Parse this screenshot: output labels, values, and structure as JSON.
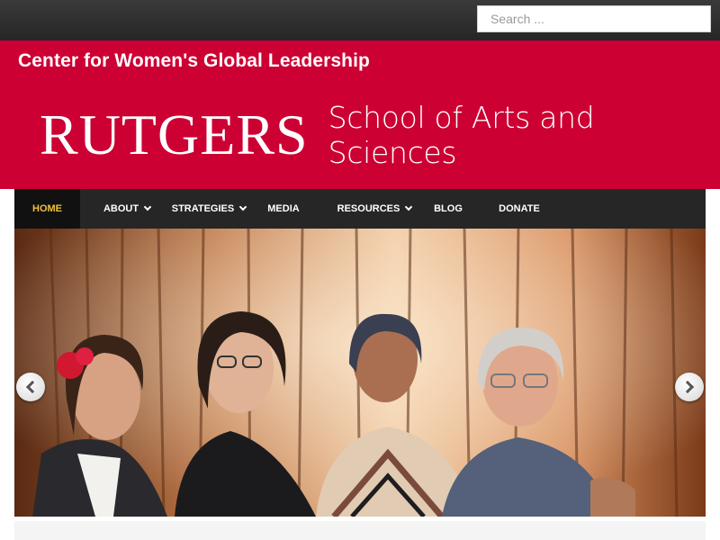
{
  "search": {
    "placeholder": "Search ..."
  },
  "header": {
    "site_title": "Center for Women's Global Leadership",
    "logo_wordmark": "RUTGERS",
    "logo_school": "School of Arts and Sciences"
  },
  "nav": {
    "items": [
      {
        "label": "HOME",
        "active": true,
        "has_submenu": false
      },
      {
        "label": "ABOUT",
        "active": false,
        "has_submenu": true
      },
      {
        "label": "STRATEGIES",
        "active": false,
        "has_submenu": true
      },
      {
        "label": "MEDIA",
        "active": false,
        "has_submenu": false
      },
      {
        "label": "RESOURCES",
        "active": false,
        "has_submenu": true
      },
      {
        "label": "BLOG",
        "active": false,
        "has_submenu": false
      },
      {
        "label": "DONATE",
        "active": false,
        "has_submenu": false
      }
    ]
  },
  "slider": {
    "prev_icon": "chevron-left-icon",
    "next_icon": "chevron-right-icon"
  },
  "colors": {
    "brand_red": "#cc0033",
    "nav_bg": "#262626",
    "nav_active_text": "#f0c23b",
    "topbar_bg": "#2e2e2e"
  }
}
